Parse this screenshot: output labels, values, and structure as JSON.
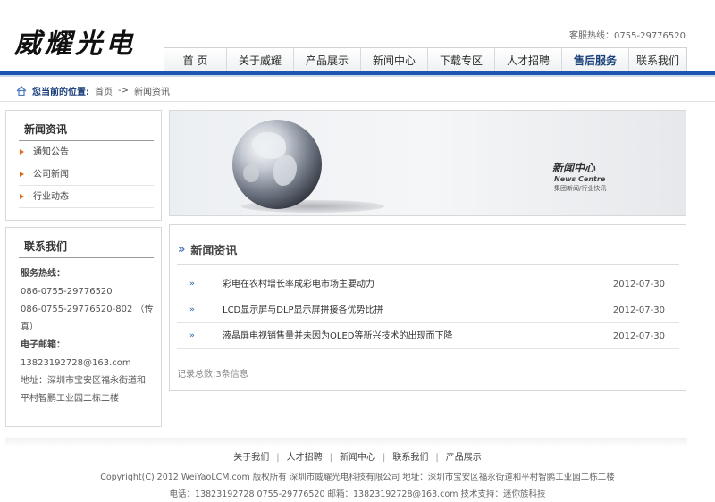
{
  "header": {
    "logo_text": "威耀光电",
    "hotline_label": "客服热线：",
    "hotline_number": "0755-29776520"
  },
  "nav": {
    "items": [
      {
        "label": "首 页"
      },
      {
        "label": "关于威耀"
      },
      {
        "label": "产品展示"
      },
      {
        "label": "新闻中心"
      },
      {
        "label": "下载专区"
      },
      {
        "label": "人才招聘"
      },
      {
        "label": "售后服务"
      },
      {
        "label": "联系我们"
      }
    ]
  },
  "breadcrumb": {
    "you_are_here": "您当前的位置:",
    "home": "首页",
    "arrow": "->",
    "current": "新闻资讯"
  },
  "sidebar": {
    "news_title": "新闻资讯",
    "news_items": [
      {
        "label": "通知公告"
      },
      {
        "label": "公司新闻"
      },
      {
        "label": "行业动态"
      }
    ],
    "contact_title": "联系我们",
    "contact": {
      "service_label": "服务热线：",
      "phone1": "086-0755-29776520",
      "phone2": "086-0755-29776520-802 （传",
      "phone2_cont": "真）",
      "email_label": "电子邮箱：",
      "email": "13823192728@163.com",
      "address_line1": "地址：深圳市宝安区福永街道和",
      "address_line2": "平村智鹏工业园二栋二楼"
    }
  },
  "banner": {
    "title_cn": "新闻中心",
    "title_en": "News Centre",
    "subtitle": "集团新闻/行业快讯"
  },
  "news": {
    "heading": "新闻资讯",
    "bullet": "»",
    "items": [
      {
        "title": "彩电在农村增长率成彩电市场主要动力",
        "date": "2012-07-30"
      },
      {
        "title": "LCD显示屏与DLP显示屏拼接各优势比拼",
        "date": "2012-07-30"
      },
      {
        "title": "液晶屏电视销售量并未因为OLED等新兴技术的出现而下降",
        "date": "2012-07-30"
      }
    ],
    "total": "记录总数:3条信息"
  },
  "footer": {
    "links": [
      {
        "label": "关于我们"
      },
      {
        "label": "人才招聘"
      },
      {
        "label": "新闻中心"
      },
      {
        "label": "联系我们"
      },
      {
        "label": "产品展示"
      }
    ],
    "separator": "|",
    "copyright": "Copyright(C) 2012 WeiYaoLCM.com 版权所有 深圳市威耀光电科技有限公司 地址：深圳市宝安区福永街道和平村智鹏工业园二栋二楼",
    "contact": "电话：13823192728 0755-29776520 邮箱：13823192728@163.com 技术支持：迷你族科技"
  },
  "colors": {
    "accent_blue": "#1d56b0",
    "active_nav": "#1a3f7a",
    "bullet_orange": "#e06a1a"
  }
}
